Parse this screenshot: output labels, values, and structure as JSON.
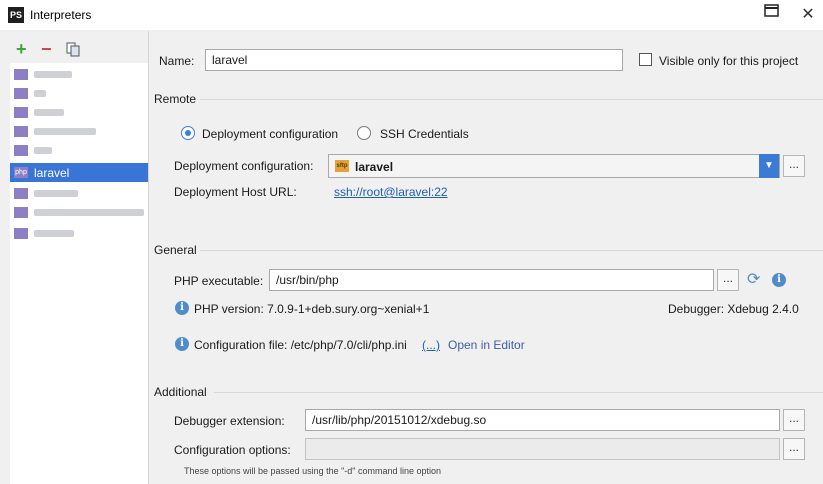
{
  "window": {
    "app_icon_text": "PS",
    "title": "Interpreters",
    "close_glyph": "✕"
  },
  "sidebar": {
    "add_glyph": "+",
    "remove_glyph": "−",
    "items": [
      {
        "label": "",
        "blurred": true
      },
      {
        "label": "",
        "blurred": true
      },
      {
        "label": "",
        "blurred": true
      },
      {
        "label": "",
        "blurred": true
      },
      {
        "label": "",
        "blurred": true
      },
      {
        "label": "laravel",
        "blurred": false,
        "selected": true,
        "icon_text": "php"
      },
      {
        "label": "",
        "blurred": true
      },
      {
        "label": "",
        "blurred": true
      },
      {
        "label": "",
        "blurred": true
      }
    ]
  },
  "form": {
    "name_label": "Name:",
    "name_value": "laravel",
    "visible_only_label": "Visible only for this project",
    "remote": {
      "title": "Remote",
      "radio_deployment": "Deployment configuration",
      "radio_ssh": "SSH Credentials",
      "deployment_label": "Deployment configuration:",
      "deployment_value": "laravel",
      "deployment_icon_text": "sftp",
      "host_url_label": "Deployment Host URL:",
      "host_url_value": "ssh://root@laravel:22",
      "dots": "..."
    },
    "general": {
      "title": "General",
      "php_exe_label": "PHP executable:",
      "php_exe_value": "/usr/bin/php",
      "dots": "...",
      "php_version": "PHP version: 7.0.9-1+deb.sury.org~xenial+1",
      "debugger": "Debugger:  Xdebug 2.4.0",
      "config_file": "Configuration file: /etc/php/7.0/cli/php.ini",
      "config_file_more": "(...)",
      "open_in_editor": "Open in Editor",
      "info_glyph": "i"
    },
    "additional": {
      "title": "Additional",
      "debugger_ext_label": "Debugger extension:",
      "debugger_ext_value": "/usr/lib/php/20151012/xdebug.so",
      "config_options_label": "Configuration options:",
      "config_options_value": "",
      "dots": "...",
      "hint": "These options will be passed using the \"-d\" command line option"
    }
  }
}
